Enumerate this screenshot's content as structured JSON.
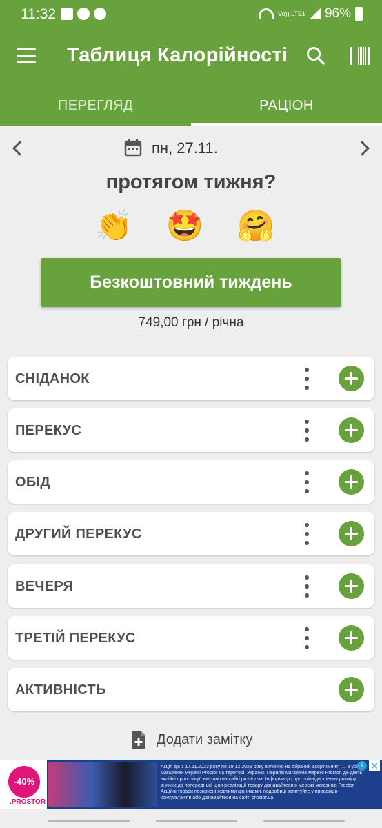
{
  "status_bar": {
    "time": "11:32",
    "battery": "96%",
    "network": "Vo)) LTE1",
    "notification_icons": [
      "gallery-icon",
      "viber-icon",
      "megaphone-icon"
    ]
  },
  "toolbar": {
    "title": "Таблиця Калорійності",
    "icons": [
      "menu-icon",
      "search-icon",
      "barcode-icon"
    ]
  },
  "tabs": [
    {
      "label": "ПЕРЕГЛЯД",
      "active": false
    },
    {
      "label": "РАЦІОН",
      "active": true
    }
  ],
  "date_nav": {
    "date": "пн, 27.11."
  },
  "promo": {
    "question": "протягом тижня?",
    "emojis": "👏 🤩 🤗",
    "button_label": "Безкоштовний тиждень",
    "price": "749,00 грн / річна"
  },
  "meals": [
    {
      "label": "СНІДАНОК",
      "has_menu": true
    },
    {
      "label": "ПЕРЕКУС",
      "has_menu": true
    },
    {
      "label": "ОБІД",
      "has_menu": true
    },
    {
      "label": "ДРУГИЙ ПЕРЕКУС",
      "has_menu": true
    },
    {
      "label": "ВЕЧЕРЯ",
      "has_menu": true
    },
    {
      "label": "ТРЕТІЙ ПЕРЕКУС",
      "has_menu": true
    },
    {
      "label": "АКТИВНІСТЬ",
      "has_menu": false
    }
  ],
  "note": {
    "label": "Додати замітку"
  },
  "ad": {
    "discount": "-40%",
    "brand": ".PROSTOR",
    "fine_print": "Акція діє з 17.11.2023 року по 19.12.2023 року включно на обраний асортимент Т... в усіх магазинах мережі Prostor на території України. Перелік магазинів мережі Prostor, де діють акційні пропозиції, вказано на сайті prostor.ua. Інформацію про співвідношення розміру знижки до попередньої ціни реалізації товару дізнавайтеся в мережі магазинів Prostor. Акційні товари позначені жовтими цінниками, подробиці запитуйте у продавців-консультантів або дізнавайтеся на сайті prostor.ua.",
    "info_glyph": "i",
    "close_glyph": "✕"
  },
  "colors": {
    "primary_green": "#68a23c",
    "background": "#eeeeee",
    "card": "#ffffff",
    "ad_pink": "#e0147a"
  }
}
